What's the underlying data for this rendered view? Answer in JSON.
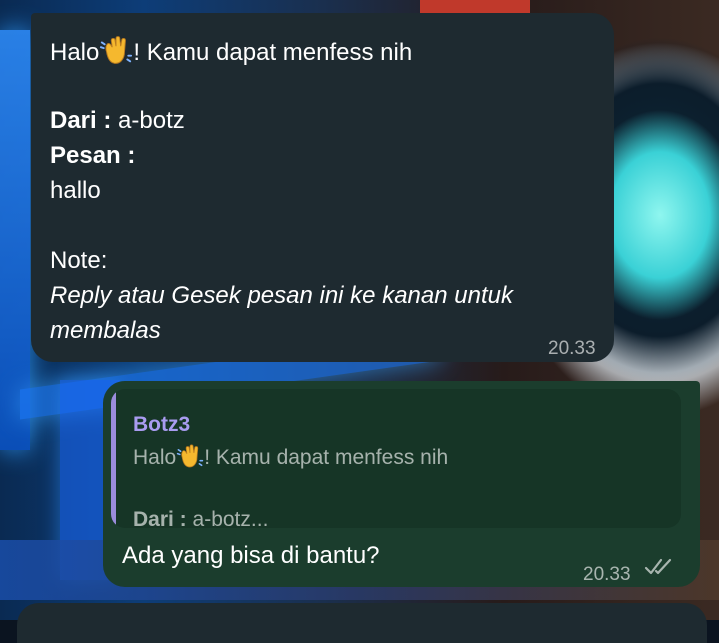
{
  "incoming_message": {
    "greeting_prefix": "Halo",
    "greeting_emoji": "waving-hand-icon",
    "greeting_suffix": "! Kamu dapat menfess nih",
    "from_label": "Dari :",
    "from_value": "a-botz",
    "message_label": "Pesan :",
    "message_value": "hallo",
    "note_label": "Note:",
    "note_line1": "Reply atau Gesek pesan ini ke kanan untuk",
    "note_line2": "membalas",
    "time": "20.33"
  },
  "outgoing_message": {
    "quote": {
      "sender": "Botz3",
      "line1_prefix": "Halo",
      "line1_suffix": "! Kamu dapat menfess nih",
      "line2_label": "Dari :",
      "line2_value": "a-botz..."
    },
    "text": "Ada yang bisa di bantu?",
    "time": "20.33",
    "status_icon": "double-check-icon"
  },
  "colors": {
    "incoming_bubble": "#1e2a30",
    "outgoing_bubble": "#1b3d2d",
    "quote_accent": "#9b8cdc",
    "quote_name": "#a99cf0"
  }
}
